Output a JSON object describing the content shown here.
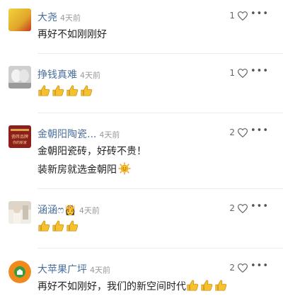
{
  "comments": [
    {
      "user": "大尧",
      "time": "4天前",
      "likes": "1",
      "text": "再好不如刚刚好",
      "avatar_color": "#e8b62a"
    },
    {
      "user": "挣钱真难",
      "time": "4天前",
      "likes": "1",
      "text": "",
      "emojis": [
        "thumbs-up",
        "thumbs-up",
        "thumbs-up",
        "thumbs-up"
      ]
    },
    {
      "user": "金朝阳陶瓷...",
      "time": "4天前",
      "likes": "2",
      "text_line1": "金朝阳瓷砖，好砖不贵！",
      "text_line2": "装新房就选金朝阳",
      "avatar_text": "瓷砖品牌 你的新家",
      "avatar_color": "#8c1f1c"
    },
    {
      "user": "涵涵ෆ",
      "crown": "👸",
      "time": "4天前",
      "likes": "2",
      "emojis": [
        "thumbs-up",
        "thumbs-up",
        "thumbs-up"
      ]
    },
    {
      "user": "大苹果广坪",
      "time": "4天前",
      "likes": "2",
      "text": "再好不如刚好，我们的新空间时代",
      "avatar_color": "#f08a1c"
    }
  ],
  "more_label": "•••",
  "colors": {
    "username": "#4a6f9d",
    "time": "#9a9a9a",
    "emoji": "#f5c12e"
  }
}
